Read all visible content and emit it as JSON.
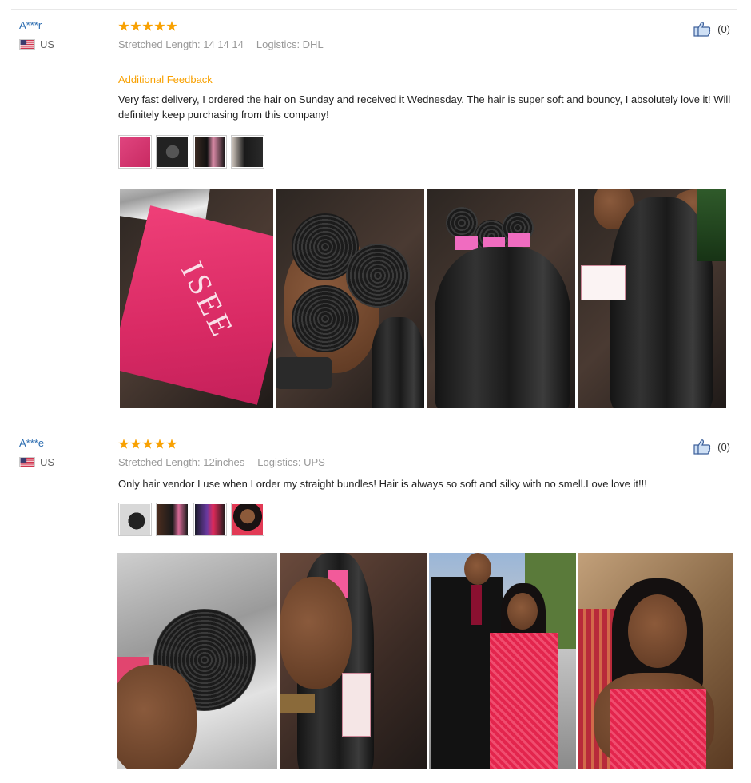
{
  "reviews": [
    {
      "user": "A***r",
      "country": "US",
      "rating": 5,
      "stretched_length": "Stretched Length: 14 14 14",
      "logistics": "Logistics: DHL",
      "helpful_count": "(0)",
      "additional_label": "Additional Feedback",
      "content": "Very fast delivery, I ordered the hair on Sunday and received it Wednesday. The hair is super soft and bouncy, I absolutely love it! Will definitely keep purchasing from this company!",
      "bag_brand": "ISEE"
    },
    {
      "user": "A***e",
      "country": "US",
      "rating": 5,
      "stretched_length": "Stretched Length: 12inches",
      "logistics": "Logistics: UPS",
      "helpful_count": "(0)",
      "content": "Only hair vendor I use when I order my straight bundles! Hair is always so soft and silky with no smell.Love love it!!!"
    }
  ],
  "colors": {
    "username": "#2b6cb0",
    "star": "#f8a102",
    "additional": "#f8a102",
    "meta": "#999999"
  },
  "icons": {
    "flag": "us-flag-icon",
    "thumb": "thumbs-up-icon",
    "star": "star-icon"
  }
}
